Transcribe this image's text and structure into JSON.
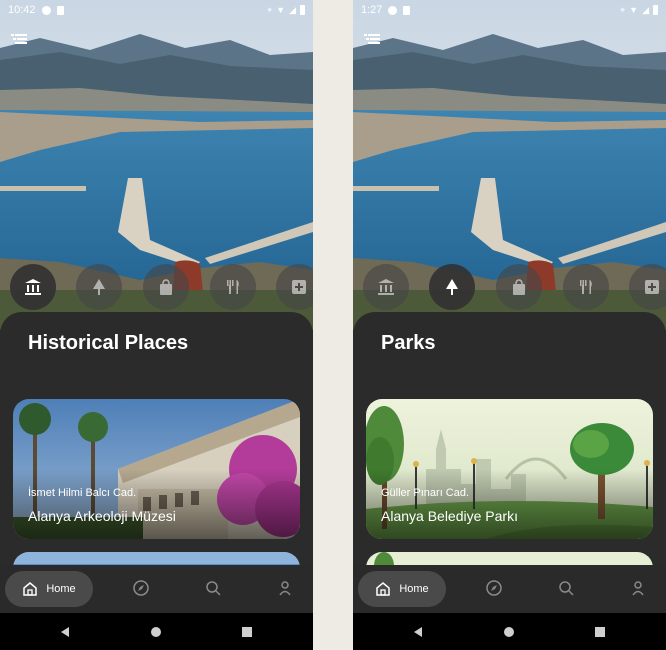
{
  "colors": {
    "sheet": "#2b2b2b",
    "nav_pill": "#4a4a4a",
    "text": "#ffffff"
  },
  "screens": [
    {
      "status_time": "10:42",
      "sheet_title": "Historical Places",
      "active_category": "museum",
      "card": {
        "address": "İsmet Hilmi Balcı Cad.",
        "name": "Alanya Arkeoloji Müzesi"
      },
      "nav_home_label": "Home"
    },
    {
      "status_time": "1:27",
      "sheet_title": "Parks",
      "active_category": "park",
      "card": {
        "address": "Güller Pınarı Cad.",
        "name": "Alanya Belediye Parkı"
      },
      "nav_home_label": "Home"
    }
  ],
  "categories": [
    "museum-icon",
    "park-tree-icon",
    "shopping-bag-icon",
    "restaurant-icon",
    "hospital-icon"
  ],
  "nav_icons": [
    "home-icon",
    "compass-icon",
    "search-icon",
    "profile-icon"
  ]
}
